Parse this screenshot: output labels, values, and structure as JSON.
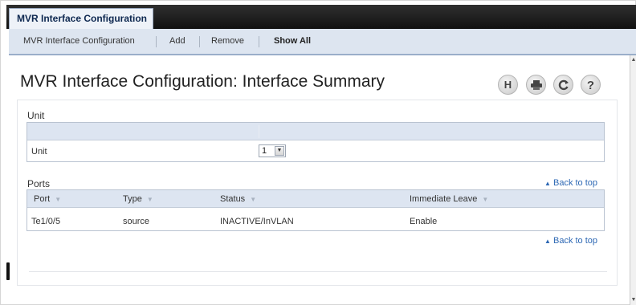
{
  "header": {
    "main_tab_label": "MVR Interface Configuration"
  },
  "subnav": {
    "items": [
      {
        "label": "MVR Interface Configuration"
      },
      {
        "label": "Add"
      },
      {
        "label": "Remove"
      },
      {
        "label": "Show All"
      }
    ],
    "active_index": 3
  },
  "page": {
    "title": "MVR Interface Configuration: Interface Summary"
  },
  "toolbar": {
    "icons": [
      "save-icon",
      "print-icon",
      "refresh-icon",
      "help-icon"
    ]
  },
  "unit_section": {
    "label": "Unit",
    "row_label": "Unit",
    "select_value": "1"
  },
  "ports_section": {
    "label": "Ports",
    "back_to_top_top": "Back to top",
    "back_to_top_bottom": "Back to top",
    "columns": [
      "Port",
      "Type",
      "Status",
      "Immediate Leave"
    ],
    "rows": [
      {
        "port": "Te1/0/5",
        "type": "source",
        "status": "INACTIVE/InVLAN",
        "immediate_leave": "Enable"
      }
    ]
  },
  "colors": {
    "link": "#2d68b4",
    "header_bar": "#111111",
    "table_header": "#dde5f1"
  }
}
